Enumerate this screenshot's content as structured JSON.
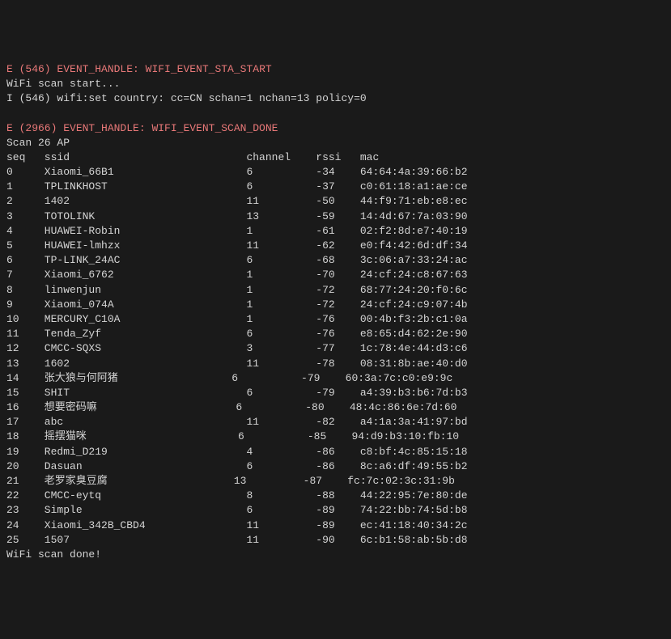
{
  "log": {
    "line1_prefix": "E (546) EVENT_HANDLE: ",
    "line1_event": "WIFI_EVENT_STA_START",
    "line2": "WiFi scan start...",
    "line3": "I (546) wifi:set country: cc=CN schan=1 nchan=13 policy=0",
    "line4": "",
    "line5_prefix": "E (2966) EVENT_HANDLE: ",
    "line5_event": "WIFI_EVENT_SCAN_DONE",
    "line6": "Scan 26 AP",
    "header": "seq   ssid                            channel    rssi   mac",
    "footer": "WiFi scan done!"
  },
  "rows": [
    "0     Xiaomi_66B1                     6          -34    64:64:4a:39:66:b2",
    "1     TPLINKHOST                      6          -37    c0:61:18:a1:ae:ce",
    "2     1402                            11         -50    44:f9:71:eb:e8:ec",
    "3     TOTOLINK                        13         -59    14:4d:67:7a:03:90",
    "4     HUAWEI-Robin                    1          -61    02:f2:8d:e7:40:19",
    "5     HUAWEI-lmhzx                    11         -62    e0:f4:42:6d:df:34",
    "6     TP-LINK_24AC                    6          -68    3c:06:a7:33:24:ac",
    "7     Xiaomi_6762                     1          -70    24:cf:24:c8:67:63",
    "8     linwenjun                       1          -72    68:77:24:20:f0:6c",
    "9     Xiaomi_074A                     1          -72    24:cf:24:c9:07:4b",
    "10    MERCURY_C10A                    1          -76    00:4b:f3:2b:c1:0a",
    "11    Tenda_Zyf                       6          -76    e8:65:d4:62:2e:90",
    "12    CMCC-SQXS                       3          -77    1c:78:4e:44:d3:c6",
    "13    1602                            11         -78    08:31:8b:ae:40:d0",
    "14    张大狼与何阿猪                  6          -79    60:3a:7c:c0:e9:9c",
    "15    SHIT                            6          -79    a4:39:b3:b6:7d:b3",
    "16    想要密码嘛                      6          -80    48:4c:86:6e:7d:60",
    "17    abc                             11         -82    a4:1a:3a:41:97:bd",
    "18    摇摆猫咪                        6          -85    94:d9:b3:10:fb:10",
    "19    Redmi_D219                      4          -86    c8:bf:4c:85:15:18",
    "20    Dasuan                          6          -86    8c:a6:df:49:55:b2",
    "21    老罗家臭豆腐                    13         -87    fc:7c:02:3c:31:9b",
    "22    CMCC-eytq                       8          -88    44:22:95:7e:80:de",
    "23    Simple                          6          -89    74:22:bb:74:5d:b8",
    "24    Xiaomi_342B_CBD4                11         -89    ec:41:18:40:34:2c",
    "25    1507                            11         -90    6c:b1:58:ab:5b:d8"
  ]
}
